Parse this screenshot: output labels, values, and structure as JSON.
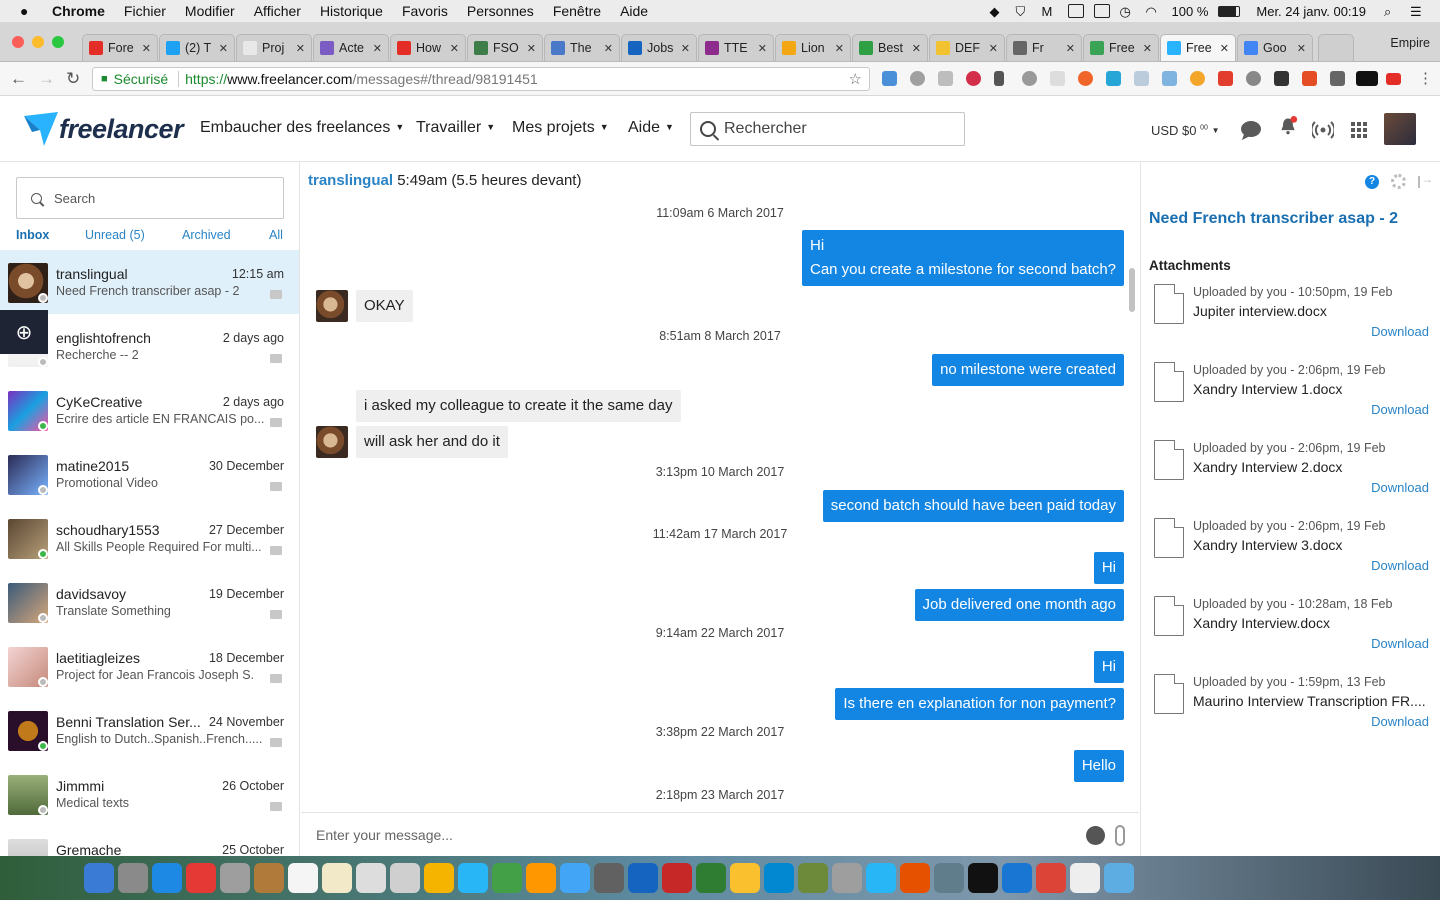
{
  "menubar": {
    "apple": "",
    "app": "Chrome",
    "items": [
      "Fichier",
      "Modifier",
      "Afficher",
      "Historique",
      "Favoris",
      "Personnes",
      "Fenêtre",
      "Aide"
    ],
    "battery": "100 %",
    "datetime": "Mer. 24 janv. 00:19"
  },
  "tabs": {
    "items": [
      {
        "label": "Fore",
        "color": "#e52d27"
      },
      {
        "label": "(2) T",
        "color": "#1da1f2"
      },
      {
        "label": "Proj",
        "color": "#e8e8e8"
      },
      {
        "label": "Acte",
        "color": "#7a5cc2"
      },
      {
        "label": "How",
        "color": "#e52d27"
      },
      {
        "label": "FSO",
        "color": "#3c7d4a"
      },
      {
        "label": "The",
        "color": "#4a79c9"
      },
      {
        "label": "Jobs",
        "color": "#1565c0"
      },
      {
        "label": "TTE",
        "color": "#8e2c8e"
      },
      {
        "label": "Lion",
        "color": "#f3a712"
      },
      {
        "label": "Best",
        "color": "#2ea043"
      },
      {
        "label": "DEF",
        "color": "#f2c230"
      },
      {
        "label": "Fr",
        "color": "#666666"
      },
      {
        "label": "Free",
        "color": "#3aa356"
      },
      {
        "label": "Free",
        "color": "#29b2fe"
      },
      {
        "label": "Goo",
        "color": "#4285f4"
      }
    ],
    "active_index": 14,
    "profile": "Empire"
  },
  "address": {
    "secure_label": "Sécurisé",
    "proto": "https://",
    "host": "www.freelancer.com",
    "path": "/messages#/thread/98191451"
  },
  "header": {
    "logo": "freelancer",
    "nav": [
      "Embaucher des freelances",
      "Travailler",
      "Mes projets",
      "Aide"
    ],
    "search_placeholder": "Rechercher",
    "balance": "USD $0",
    "balance_cents": "00"
  },
  "sidebar": {
    "search_placeholder": "Search",
    "filters": [
      "Inbox",
      "Unread (5)",
      "Archived",
      "All"
    ],
    "contacts": [
      {
        "name": "translingual",
        "time": "12:15 am",
        "sub": "Need French transcriber asap - 2",
        "status": "#bbbbbb"
      },
      {
        "name": "englishtofrench",
        "time": "2 days ago",
        "sub": "Recherche -- 2",
        "status": "#bbbbbb"
      },
      {
        "name": "CyKeCreative",
        "time": "2 days ago",
        "sub": "Ecrire des article EN FRANCAIS po...",
        "status": "#3cb84a"
      },
      {
        "name": "matine2015",
        "time": "30 December",
        "sub": "Promotional Video",
        "status": "#bbbbbb"
      },
      {
        "name": "schoudhary1553",
        "time": "27 December",
        "sub": "All Skills People Required For multi...",
        "status": "#3cb84a"
      },
      {
        "name": "davidsavoy",
        "time": "19 December",
        "sub": "Translate Something",
        "status": "#bbbbbb"
      },
      {
        "name": "laetitiagleizes",
        "time": "18 December",
        "sub": "Project for Jean Francois Joseph S.",
        "status": "#bbbbbb"
      },
      {
        "name": "Benni Translation Ser...",
        "time": "24 November",
        "sub": "English to Dutch..Spanish..French.....",
        "status": "#3cb84a"
      },
      {
        "name": "Jimmmi",
        "time": "26 October",
        "sub": "Medical texts",
        "status": "#bbbbbb"
      },
      {
        "name": "Gremache",
        "time": "25 October",
        "sub": "",
        "status": "#bbbbbb"
      }
    ]
  },
  "chat": {
    "user": "translingual",
    "local_time": "5:49am (5.5 heures devant)",
    "messages": [
      {
        "kind": "ts",
        "text": "11:09am 6 March 2017"
      },
      {
        "kind": "out",
        "text": "Hi\nCan you create a milestone for second batch?"
      },
      {
        "kind": "in",
        "text": "OKAY"
      },
      {
        "kind": "ts",
        "text": "8:51am 8 March 2017"
      },
      {
        "kind": "out",
        "text": "no milestone were created"
      },
      {
        "kind": "in",
        "text": "i asked my colleague to create it the same day"
      },
      {
        "kind": "in",
        "text": "will ask her and do it"
      },
      {
        "kind": "ts",
        "text": "3:13pm 10 March 2017"
      },
      {
        "kind": "out",
        "text": "second batch should have been paid today"
      },
      {
        "kind": "ts",
        "text": "11:42am 17 March 2017"
      },
      {
        "kind": "out",
        "text": "Hi"
      },
      {
        "kind": "out",
        "text": "Job delivered one month ago"
      },
      {
        "kind": "ts",
        "text": "9:14am 22 March 2017"
      },
      {
        "kind": "out",
        "text": "Hi"
      },
      {
        "kind": "out",
        "text": "Is there en explanation for non payment?"
      },
      {
        "kind": "ts",
        "text": "3:38pm 22 March 2017"
      },
      {
        "kind": "out",
        "text": "Hello"
      },
      {
        "kind": "ts",
        "text": "2:18pm 23 March 2017"
      }
    ],
    "composer_placeholder": "Enter your message..."
  },
  "details": {
    "project_title": "Need French transcriber asap - 2",
    "attachments_label": "Attachments",
    "download_label": "Download",
    "help_glyph": "?",
    "attachments": [
      {
        "uploaded": "Uploaded by you - 10:50pm, 19 Feb",
        "file": "Jupiter interview.docx"
      },
      {
        "uploaded": "Uploaded by you - 2:06pm, 19 Feb",
        "file": "Xandry Interview 1.docx"
      },
      {
        "uploaded": "Uploaded by you - 2:06pm, 19 Feb",
        "file": "Xandry Interview 2.docx"
      },
      {
        "uploaded": "Uploaded by you - 2:06pm, 19 Feb",
        "file": "Xandry Interview 3.docx"
      },
      {
        "uploaded": "Uploaded by you - 10:28am, 18 Feb",
        "file": "Xandry Interview.docx"
      },
      {
        "uploaded": "Uploaded by you - 1:59pm, 13 Feb",
        "file": "Maurino Interview Transcription FR...."
      }
    ]
  },
  "dock": {
    "colors": [
      "#3a7bd5",
      "#8a8a8a",
      "#1e88e5",
      "#e53935",
      "#9e9e9e",
      "#b07a3a",
      "#f5f5f5",
      "#f2e9c9",
      "#dddddd",
      "#cfcfcf",
      "#f4b400",
      "#29b6f6",
      "#43a047",
      "#ff9800",
      "#42a5f5",
      "#616161",
      "#1565c0",
      "#c62828",
      "#2e7d32",
      "#fbc02d",
      "#0288d1",
      "#6d8a3a",
      "#9e9e9e",
      "#29b6f6",
      "#e65100",
      "#607d8b",
      "#111111",
      "#1976d2",
      "#db4437",
      "#eeeeee",
      "#5dade2"
    ]
  }
}
